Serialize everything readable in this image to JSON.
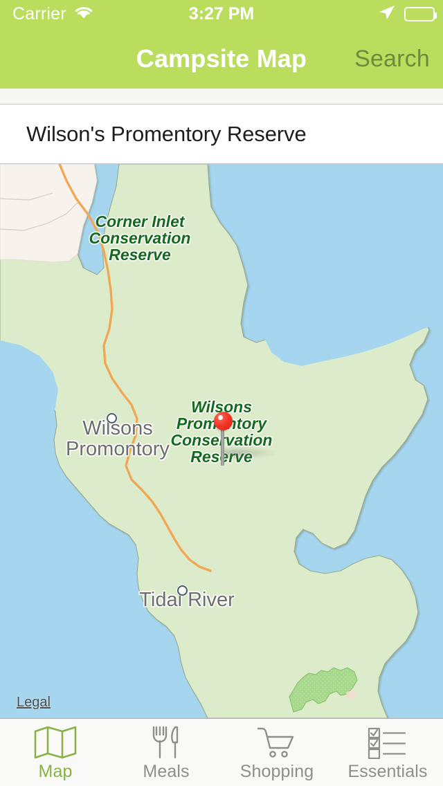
{
  "status_bar": {
    "carrier": "Carrier",
    "wifi_icon": "wifi-icon",
    "time": "3:27 PM",
    "location_icon": "location-arrow-icon",
    "battery_icon": "battery-full-icon"
  },
  "nav_bar": {
    "title": "Campsite Map",
    "search_label": "Search",
    "background_color": "#bbdd5e",
    "title_color": "#ffffff",
    "search_color": "#6f8a3c"
  },
  "place_row": {
    "name": "Wilson's Promentory Reserve"
  },
  "map": {
    "water_color": "#a6d6ef",
    "land_color": "#dceccb",
    "park_color": "#a8d88c",
    "urban_color": "#f7f2ec",
    "road_color": "#f0a856",
    "legal_label": "Legal",
    "labels": [
      {
        "name": "corner-inlet-label",
        "text": "Corner Inlet\nConservation\nReserve",
        "style": "green-italic"
      },
      {
        "name": "wilsons-reserve-label",
        "text": "Wilsons\nPromontory\nConservation\nReserve",
        "style": "green-italic"
      },
      {
        "name": "wilsons-promontory-label",
        "text": "Wilsons\nPromontory",
        "style": "gray"
      },
      {
        "name": "tidal-river-label",
        "text": "Tidal River",
        "style": "gray"
      }
    ],
    "pin": {
      "name": "campsite-map-pin",
      "color": "#ee2a1a"
    }
  },
  "tab_bar": {
    "items": [
      {
        "id": "map",
        "label": "Map",
        "icon": "folded-map-icon",
        "active": true
      },
      {
        "id": "meals",
        "label": "Meals",
        "icon": "fork-knife-icon",
        "active": false
      },
      {
        "id": "shopping",
        "label": "Shopping",
        "icon": "shopping-cart-icon",
        "active": false
      },
      {
        "id": "essentials",
        "label": "Essentials",
        "icon": "checklist-icon",
        "active": false
      }
    ],
    "active_color": "#8ab046",
    "inactive_color": "#8e8e8e"
  }
}
